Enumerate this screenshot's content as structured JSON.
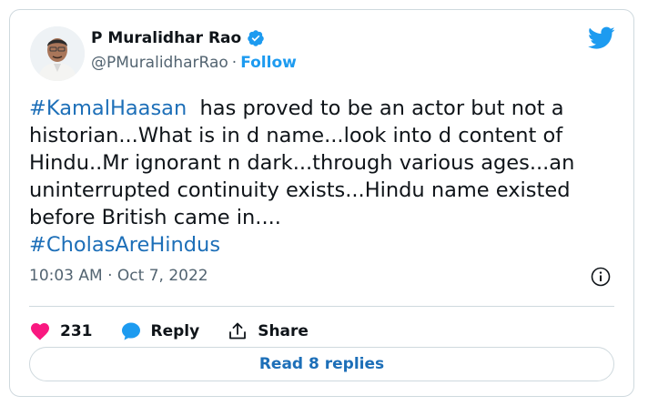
{
  "tweet": {
    "author": {
      "name": "P Muralidhar Rao",
      "handle": "@PMuralidharRao",
      "separator": "·",
      "follow_label": "Follow"
    },
    "text_lines": [
      {
        "hashtag": "#KamalHaasan",
        "text": "  has proved to be an actor but not a"
      },
      {
        "text": "historian...What is in d name...look into d content of"
      },
      {
        "text": "Hindu..Mr ignorant n dark...through various ages...an"
      },
      {
        "text": "uninterrupted continuity exists...Hindu name existed"
      },
      {
        "text": "before British came in...."
      },
      {
        "hashtag": "#CholasAreHindus"
      }
    ],
    "timestamp": "10:03 AM · Oct 7, 2022",
    "actions": {
      "like_count": "231",
      "reply_label": "Reply",
      "share_label": "Share"
    },
    "read_replies_label": "Read 8 replies"
  },
  "colors": {
    "accent": "#1d9bf0",
    "hashtag": "#1d6fb8",
    "like": "#f91880",
    "muted": "#536471",
    "text": "#0f1419",
    "border": "#cfd9de"
  },
  "icons": [
    "verified-badge-icon",
    "twitter-bird-icon",
    "info-icon",
    "heart-icon",
    "reply-bubble-icon",
    "share-icon"
  ]
}
